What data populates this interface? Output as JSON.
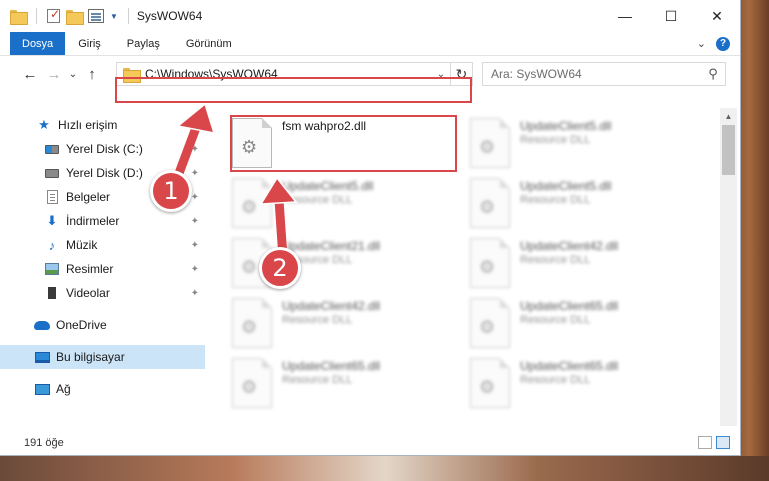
{
  "window": {
    "title": "SysWOW64",
    "minimize_glyph": "—",
    "maximize_glyph": "☐",
    "close_glyph": "✕"
  },
  "ribbon": {
    "tabs": [
      "Dosya",
      "Giriş",
      "Paylaş",
      "Görünüm"
    ],
    "expand_glyph": "⌄",
    "help_glyph": "?"
  },
  "nav": {
    "back_glyph": "←",
    "forward_glyph": "→",
    "recent_glyph": "⌄",
    "up_glyph": "↑"
  },
  "address": {
    "path": "C:\\Windows\\SysWOW64",
    "dropdown_glyph": "⌄",
    "refresh_glyph": "↻"
  },
  "search": {
    "placeholder": "Ara: SysWOW64",
    "icon_glyph": "⚲"
  },
  "sidebar": {
    "items": [
      {
        "label": "Hızlı erişim",
        "icon": "star-icon"
      },
      {
        "label": "Yerel Disk (C:)",
        "icon": "drive-icon"
      },
      {
        "label": "Yerel Disk (D:)",
        "icon": "drive-icon"
      },
      {
        "label": "Belgeler",
        "icon": "documents-icon"
      },
      {
        "label": "İndirmeler",
        "icon": "download-icon"
      },
      {
        "label": "Müzik",
        "icon": "music-icon"
      },
      {
        "label": "Resimler",
        "icon": "pictures-icon"
      },
      {
        "label": "Videolar",
        "icon": "videos-icon"
      },
      {
        "label": "OneDrive",
        "icon": "cloud-icon"
      },
      {
        "label": "Bu bilgisayar",
        "icon": "computer-icon"
      },
      {
        "label": "Ağ",
        "icon": "network-icon"
      }
    ],
    "pin_glyph": "📌"
  },
  "files": [
    {
      "name": "fsm wahpro2.dll",
      "type": ""
    },
    {
      "name": "UpdateClient5.dll",
      "type": "Resource DLL"
    },
    {
      "name": "UpdateClient5.dll",
      "type": "Resource DLL"
    },
    {
      "name": "UpdateClient5.dll",
      "type": "Resource DLL"
    },
    {
      "name": "UpdateClient21.dll",
      "type": "Resource DLL"
    },
    {
      "name": "UpdateClient42.dll",
      "type": "Resource DLL"
    },
    {
      "name": "UpdateClient42.dll",
      "type": "Resource DLL"
    },
    {
      "name": "UpdateClient65.dll",
      "type": "Resource DLL"
    },
    {
      "name": "UpdateClient65.dll",
      "type": "Resource DLL"
    },
    {
      "name": "UpdateClient65.dll",
      "type": "Resource DLL"
    }
  ],
  "status": {
    "item_count": "191 öğe"
  },
  "annotations": {
    "step1": "1",
    "step2": "2",
    "color": "#d9474a"
  }
}
